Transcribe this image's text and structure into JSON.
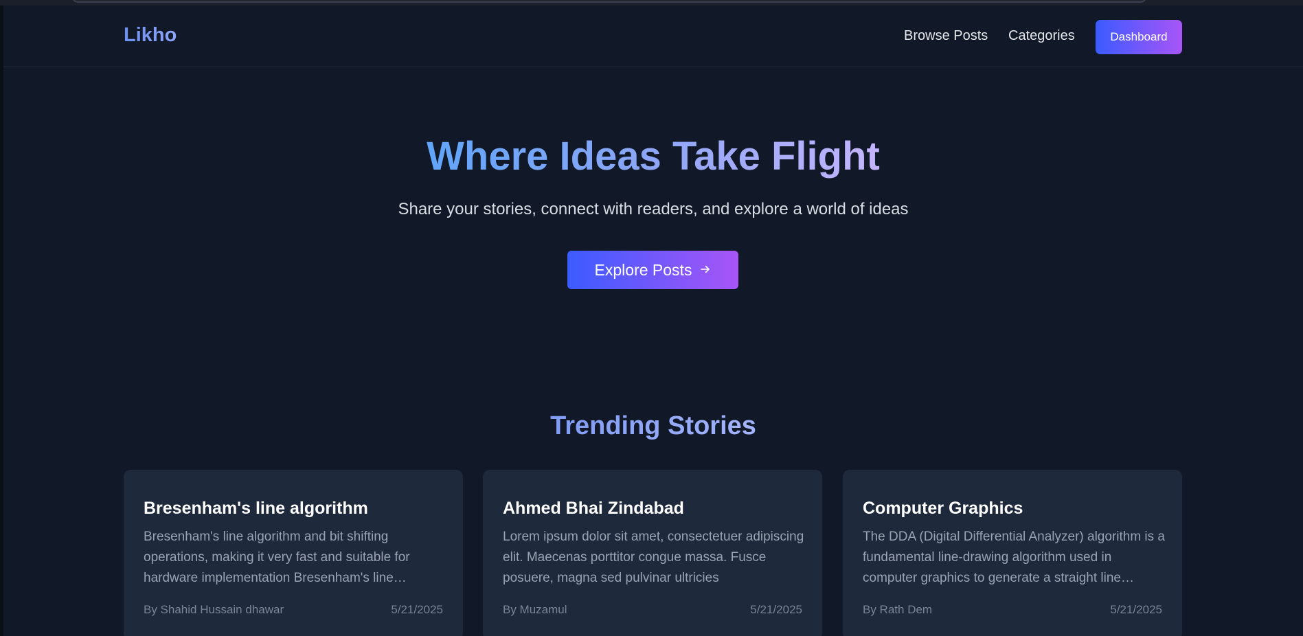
{
  "header": {
    "logo": "Likho",
    "nav": {
      "browse_posts": "Browse Posts",
      "categories": "Categories",
      "dashboard": "Dashboard"
    }
  },
  "hero": {
    "title": "Where Ideas Take Flight",
    "subtitle": "Share your stories, connect with readers, and explore a world of ideas",
    "cta_label": "Explore Posts",
    "cta_icon": "arrow-right-icon"
  },
  "trending": {
    "title": "Trending Stories",
    "posts": [
      {
        "title": "Bresenham's line algorithm",
        "excerpt": "Bresenham's line algorithm and bit shifting operations, making it very fast and suitable for hardware implementation Bresenham's line algorithm",
        "author": "By Shahid Hussain dhawar",
        "date": "5/21/2025"
      },
      {
        "title": "Ahmed Bhai Zindabad",
        "excerpt": "Lorem ipsum dolor sit amet, consectetuer adipiscing elit. Maecenas porttitor congue massa. Fusce posuere, magna sed pulvinar ultricies",
        "author": "By Muzamul",
        "date": "5/21/2025"
      },
      {
        "title": "Computer Graphics",
        "excerpt": "The DDA (Digital Differential Analyzer) algorithm is a fundamental line-drawing algorithm used in computer graphics to generate a straight line between",
        "author": "By Rath Dem",
        "date": "5/21/2025"
      }
    ]
  },
  "colors": {
    "background": "#111827",
    "card": "#1e293b",
    "accent_start": "#3b5bff",
    "accent_end": "#a855f7"
  }
}
